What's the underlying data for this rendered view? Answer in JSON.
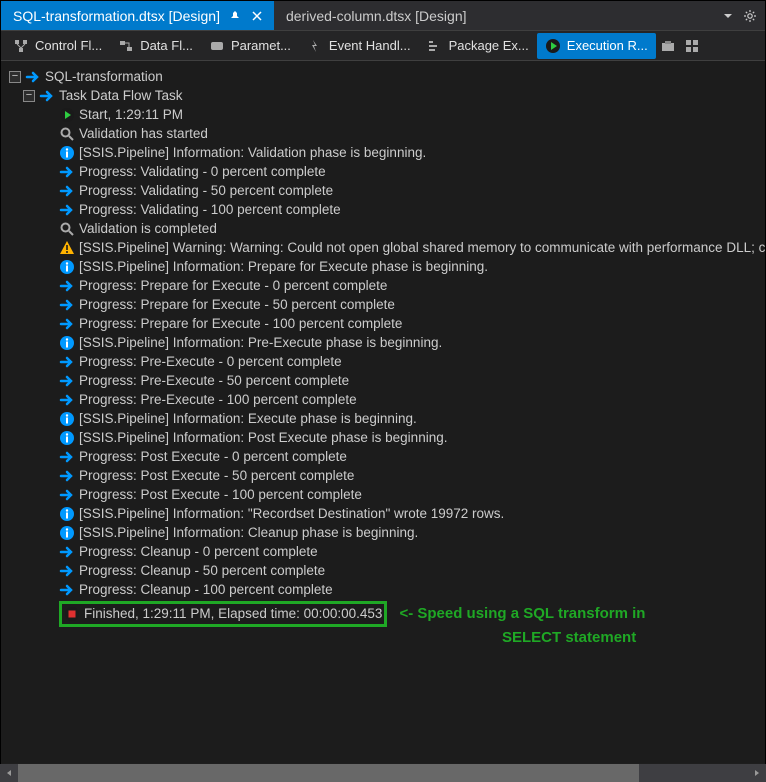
{
  "tabs": {
    "active": "SQL-transformation.dtsx [Design]",
    "inactive": "derived-column.dtsx [Design]"
  },
  "toolbar": {
    "control_flow": "Control Fl...",
    "data_flow": "Data Fl...",
    "parameters": "Paramet...",
    "event_handlers": "Event Handl...",
    "package_explorer": "Package Ex...",
    "execution_results": "Execution R..."
  },
  "tree": {
    "root": "SQL-transformation",
    "task": "Task Data Flow Task",
    "lines": [
      {
        "icon": "play",
        "text": "Start, 1:29:11 PM"
      },
      {
        "icon": "search",
        "text": "Validation has started"
      },
      {
        "icon": "info",
        "text": "[SSIS.Pipeline] Information: Validation phase is beginning."
      },
      {
        "icon": "arrow",
        "text": "Progress: Validating - 0 percent complete"
      },
      {
        "icon": "arrow",
        "text": "Progress: Validating - 50 percent complete"
      },
      {
        "icon": "arrow",
        "text": "Progress: Validating - 100 percent complete"
      },
      {
        "icon": "search",
        "text": "Validation is completed"
      },
      {
        "icon": "warn",
        "text": "[SSIS.Pipeline] Warning: Warning: Could not open global shared memory to communicate with performance DLL; c"
      },
      {
        "icon": "info",
        "text": "[SSIS.Pipeline] Information: Prepare for Execute phase is beginning."
      },
      {
        "icon": "arrow",
        "text": "Progress: Prepare for Execute - 0 percent complete"
      },
      {
        "icon": "arrow",
        "text": "Progress: Prepare for Execute - 50 percent complete"
      },
      {
        "icon": "arrow",
        "text": "Progress: Prepare for Execute - 100 percent complete"
      },
      {
        "icon": "info",
        "text": "[SSIS.Pipeline] Information: Pre-Execute phase is beginning."
      },
      {
        "icon": "arrow",
        "text": "Progress: Pre-Execute - 0 percent complete"
      },
      {
        "icon": "arrow",
        "text": "Progress: Pre-Execute - 50 percent complete"
      },
      {
        "icon": "arrow",
        "text": "Progress: Pre-Execute - 100 percent complete"
      },
      {
        "icon": "info",
        "text": "[SSIS.Pipeline] Information: Execute phase is beginning."
      },
      {
        "icon": "info",
        "text": "[SSIS.Pipeline] Information: Post Execute phase is beginning."
      },
      {
        "icon": "arrow",
        "text": "Progress: Post Execute - 0 percent complete"
      },
      {
        "icon": "arrow",
        "text": "Progress: Post Execute - 50 percent complete"
      },
      {
        "icon": "arrow",
        "text": "Progress: Post Execute - 100 percent complete"
      },
      {
        "icon": "info",
        "text": "[SSIS.Pipeline] Information: \"Recordset Destination\" wrote 19972 rows."
      },
      {
        "icon": "info",
        "text": "[SSIS.Pipeline] Information: Cleanup phase is beginning."
      },
      {
        "icon": "arrow",
        "text": "Progress: Cleanup - 0 percent complete"
      },
      {
        "icon": "arrow",
        "text": "Progress: Cleanup - 50 percent complete"
      },
      {
        "icon": "arrow",
        "text": "Progress: Cleanup - 100 percent complete"
      },
      {
        "icon": "stop",
        "text": "Finished, 1:29:11 PM, Elapsed time: 00:00:00.453"
      }
    ]
  },
  "annotation": {
    "line1": "<- Speed using a SQL transform in",
    "line2": "SELECT statement"
  }
}
